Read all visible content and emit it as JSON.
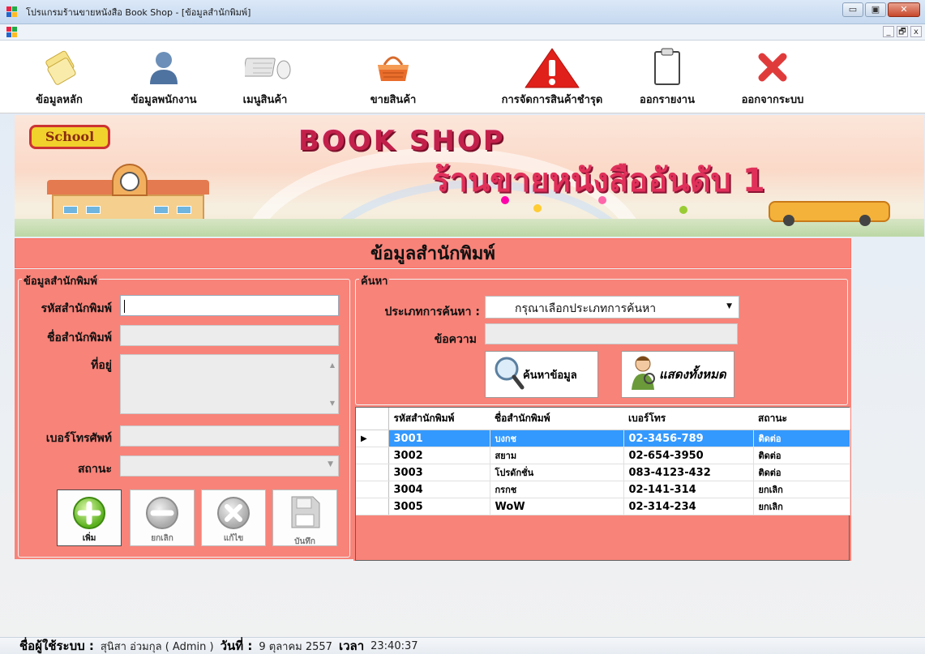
{
  "window": {
    "title": "โปรแกรมร้านขายหนังสือ Book Shop - [ข้อมูลสำนักพิมพ์]",
    "buttons": {
      "minimize": "▭",
      "maximize": "▣",
      "close": "✕"
    },
    "mdi_buttons": {
      "minimize": "_",
      "restore": "🗗",
      "close": "x"
    }
  },
  "toolbar": {
    "items": [
      {
        "label": "ข้อมูลหลัก",
        "icon": "notes-icon"
      },
      {
        "label": "ข้อมูลพนักงาน",
        "icon": "user-icon"
      },
      {
        "label": "เมนูสินค้า",
        "icon": "keyboard-mouse-icon"
      },
      {
        "label": "ขายสินค้า",
        "icon": "basket-icon"
      },
      {
        "label": "การจัดการสินค้าชำรุด",
        "icon": "warning-icon"
      },
      {
        "label": "ออกรายงาน",
        "icon": "clipboard-icon"
      },
      {
        "label": "ออกจากระบบ",
        "icon": "exit-icon"
      }
    ]
  },
  "banner": {
    "sign": "School",
    "title": "BOOK SHOP",
    "subtitle": "ร้านขายหนังสืออันดับ 1"
  },
  "section": {
    "title": "ข้อมูลสำนักพิมพ์"
  },
  "form": {
    "group_title": "ข้อมูลสำนักพิมพ์",
    "publisher_id_label": "รหัสสำนักพิมพ์",
    "publisher_id_value": "",
    "publisher_name_label": "ชื่อสำนักพิมพ์",
    "publisher_name_value": "",
    "address_label": "ที่อยู่",
    "address_value": "",
    "phone_label": "เบอร์โทรศัพท์",
    "phone_value": "",
    "status_label": "สถานะ",
    "status_value": "",
    "buttons": {
      "add": "เพิ่ม",
      "cancel": "ยกเลิก",
      "edit": "แก้ไข",
      "save": "บันทึก"
    }
  },
  "search": {
    "group_title": "ค้นหา",
    "type_label": "ประเภทการค้นหา :",
    "type_selected": "กรุณาเลือกประเภทการค้นหา",
    "text_label": "ข้อความ",
    "text_value": "",
    "search_button": "ค้นหาข้อมูล",
    "show_all_button": "แสดงทั้งหมด"
  },
  "grid": {
    "columns": [
      "รหัสสำนักพิมพ์",
      "ชื่อสำนักพิมพ์",
      "เบอร์โทร",
      "สถานะ"
    ],
    "rows": [
      {
        "id": "3001",
        "name": "บงกช",
        "phone": "02-3456-789",
        "status": "ติดต่อ",
        "selected": true
      },
      {
        "id": "3002",
        "name": "สยาม",
        "phone": "02-654-3950",
        "status": "ติดต่อ",
        "selected": false
      },
      {
        "id": "3003",
        "name": "โปรดักชั่น",
        "phone": "083-4123-432",
        "status": "ติดต่อ",
        "selected": false
      },
      {
        "id": "3004",
        "name": "กรกช",
        "phone": "02-141-314",
        "status": "ยกเลิก",
        "selected": false
      },
      {
        "id": "3005",
        "name": "WoW",
        "phone": "02-314-234",
        "status": "ยกเลิก",
        "selected": false
      }
    ],
    "row_indicator": "▶"
  },
  "status": {
    "user_label": "ชื่อผู้ใช้ระบบ :",
    "user_value": "สุนิสา อ่วมกุล  ( Admin )",
    "date_label": "วันที่ :",
    "date_value": "9 ตุลาคม 2557",
    "time_label": "เวลา",
    "time_value": "23:40:37"
  },
  "colors": {
    "panel": "#f88379",
    "selection": "#3399ff",
    "banner_text": "#e0305a"
  }
}
